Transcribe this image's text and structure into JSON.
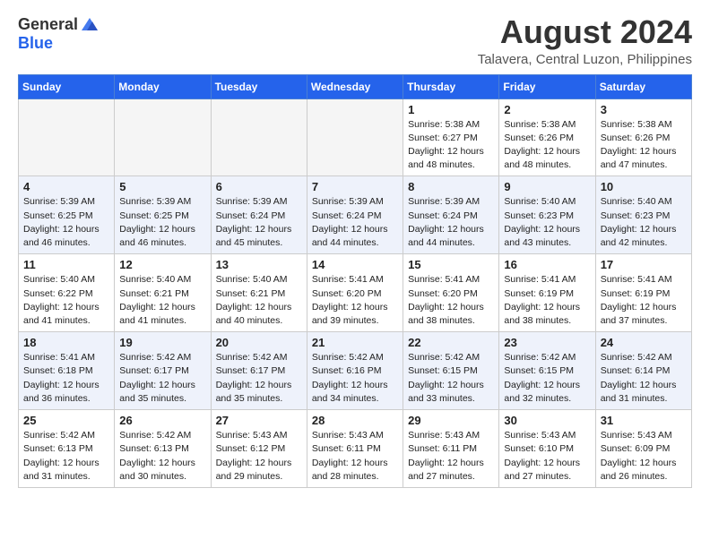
{
  "header": {
    "logo_general": "General",
    "logo_blue": "Blue",
    "month_year": "August 2024",
    "location": "Talavera, Central Luzon, Philippines"
  },
  "days_of_week": [
    "Sunday",
    "Monday",
    "Tuesday",
    "Wednesday",
    "Thursday",
    "Friday",
    "Saturday"
  ],
  "weeks": [
    [
      {
        "day": "",
        "empty": true
      },
      {
        "day": "",
        "empty": true
      },
      {
        "day": "",
        "empty": true
      },
      {
        "day": "",
        "empty": true
      },
      {
        "day": "1",
        "sunrise": "5:38 AM",
        "sunset": "6:27 PM",
        "daylight": "12 hours and 48 minutes."
      },
      {
        "day": "2",
        "sunrise": "5:38 AM",
        "sunset": "6:26 PM",
        "daylight": "12 hours and 48 minutes."
      },
      {
        "day": "3",
        "sunrise": "5:38 AM",
        "sunset": "6:26 PM",
        "daylight": "12 hours and 47 minutes."
      }
    ],
    [
      {
        "day": "4",
        "sunrise": "5:39 AM",
        "sunset": "6:25 PM",
        "daylight": "12 hours and 46 minutes."
      },
      {
        "day": "5",
        "sunrise": "5:39 AM",
        "sunset": "6:25 PM",
        "daylight": "12 hours and 46 minutes."
      },
      {
        "day": "6",
        "sunrise": "5:39 AM",
        "sunset": "6:24 PM",
        "daylight": "12 hours and 45 minutes."
      },
      {
        "day": "7",
        "sunrise": "5:39 AM",
        "sunset": "6:24 PM",
        "daylight": "12 hours and 44 minutes."
      },
      {
        "day": "8",
        "sunrise": "5:39 AM",
        "sunset": "6:24 PM",
        "daylight": "12 hours and 44 minutes."
      },
      {
        "day": "9",
        "sunrise": "5:40 AM",
        "sunset": "6:23 PM",
        "daylight": "12 hours and 43 minutes."
      },
      {
        "day": "10",
        "sunrise": "5:40 AM",
        "sunset": "6:23 PM",
        "daylight": "12 hours and 42 minutes."
      }
    ],
    [
      {
        "day": "11",
        "sunrise": "5:40 AM",
        "sunset": "6:22 PM",
        "daylight": "12 hours and 41 minutes."
      },
      {
        "day": "12",
        "sunrise": "5:40 AM",
        "sunset": "6:21 PM",
        "daylight": "12 hours and 41 minutes."
      },
      {
        "day": "13",
        "sunrise": "5:40 AM",
        "sunset": "6:21 PM",
        "daylight": "12 hours and 40 minutes."
      },
      {
        "day": "14",
        "sunrise": "5:41 AM",
        "sunset": "6:20 PM",
        "daylight": "12 hours and 39 minutes."
      },
      {
        "day": "15",
        "sunrise": "5:41 AM",
        "sunset": "6:20 PM",
        "daylight": "12 hours and 38 minutes."
      },
      {
        "day": "16",
        "sunrise": "5:41 AM",
        "sunset": "6:19 PM",
        "daylight": "12 hours and 38 minutes."
      },
      {
        "day": "17",
        "sunrise": "5:41 AM",
        "sunset": "6:19 PM",
        "daylight": "12 hours and 37 minutes."
      }
    ],
    [
      {
        "day": "18",
        "sunrise": "5:41 AM",
        "sunset": "6:18 PM",
        "daylight": "12 hours and 36 minutes."
      },
      {
        "day": "19",
        "sunrise": "5:42 AM",
        "sunset": "6:17 PM",
        "daylight": "12 hours and 35 minutes."
      },
      {
        "day": "20",
        "sunrise": "5:42 AM",
        "sunset": "6:17 PM",
        "daylight": "12 hours and 35 minutes."
      },
      {
        "day": "21",
        "sunrise": "5:42 AM",
        "sunset": "6:16 PM",
        "daylight": "12 hours and 34 minutes."
      },
      {
        "day": "22",
        "sunrise": "5:42 AM",
        "sunset": "6:15 PM",
        "daylight": "12 hours and 33 minutes."
      },
      {
        "day": "23",
        "sunrise": "5:42 AM",
        "sunset": "6:15 PM",
        "daylight": "12 hours and 32 minutes."
      },
      {
        "day": "24",
        "sunrise": "5:42 AM",
        "sunset": "6:14 PM",
        "daylight": "12 hours and 31 minutes."
      }
    ],
    [
      {
        "day": "25",
        "sunrise": "5:42 AM",
        "sunset": "6:13 PM",
        "daylight": "12 hours and 31 minutes."
      },
      {
        "day": "26",
        "sunrise": "5:42 AM",
        "sunset": "6:13 PM",
        "daylight": "12 hours and 30 minutes."
      },
      {
        "day": "27",
        "sunrise": "5:43 AM",
        "sunset": "6:12 PM",
        "daylight": "12 hours and 29 minutes."
      },
      {
        "day": "28",
        "sunrise": "5:43 AM",
        "sunset": "6:11 PM",
        "daylight": "12 hours and 28 minutes."
      },
      {
        "day": "29",
        "sunrise": "5:43 AM",
        "sunset": "6:11 PM",
        "daylight": "12 hours and 27 minutes."
      },
      {
        "day": "30",
        "sunrise": "5:43 AM",
        "sunset": "6:10 PM",
        "daylight": "12 hours and 27 minutes."
      },
      {
        "day": "31",
        "sunrise": "5:43 AM",
        "sunset": "6:09 PM",
        "daylight": "12 hours and 26 minutes."
      }
    ]
  ]
}
